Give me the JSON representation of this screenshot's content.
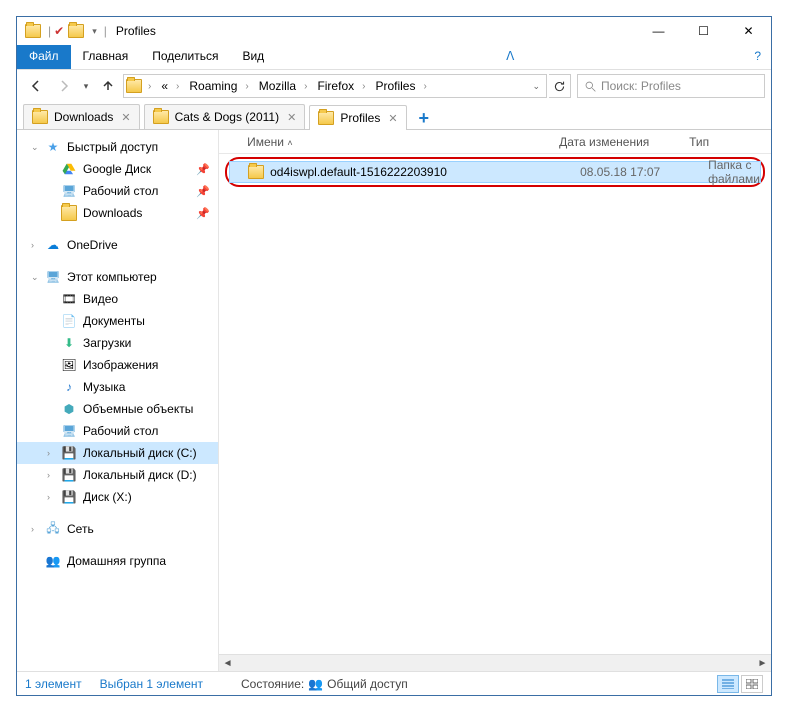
{
  "title": "Profiles",
  "win_controls": {
    "min": "—",
    "max": "☐",
    "close": "✕"
  },
  "ribbon": {
    "file": "Файл",
    "home": "Главная",
    "share": "Поделиться",
    "view": "Вид",
    "help": "?"
  },
  "breadcrumb": {
    "items": [
      "Roaming",
      "Mozilla",
      "Firefox",
      "Profiles"
    ],
    "prefix": "«"
  },
  "search": {
    "placeholder": "Поиск: Profiles"
  },
  "tabs": [
    {
      "label": "Downloads",
      "active": false
    },
    {
      "label": "Cats & Dogs (2011)",
      "active": false
    },
    {
      "label": "Profiles",
      "active": true
    }
  ],
  "columns": {
    "name": "Имени",
    "date": "Дата изменения",
    "type": "Тип"
  },
  "row": {
    "name": "od4iswpl.default-1516222203910",
    "date": "08.05.18 17:07",
    "type": "Папка с файлами"
  },
  "tree": {
    "quick": "Быстрый доступ",
    "gdrive": "Google Диск",
    "desktop": "Рабочий стол",
    "downloads": "Downloads",
    "onedrive": "OneDrive",
    "thispc": "Этот компьютер",
    "video": "Видео",
    "docs": "Документы",
    "dl2": "Загрузки",
    "pics": "Изображения",
    "music": "Музыка",
    "obj3d": "Объемные объекты",
    "desk2": "Рабочий стол",
    "diskc": "Локальный диск (C:)",
    "diskd": "Локальный диск (D:)",
    "diskx": "Диск (X:)",
    "network": "Сеть",
    "homegroup": "Домашняя группа"
  },
  "status": {
    "count": "1 элемент",
    "selected": "Выбран 1 элемент",
    "state_label": "Состояние:",
    "state_value": "Общий доступ"
  }
}
